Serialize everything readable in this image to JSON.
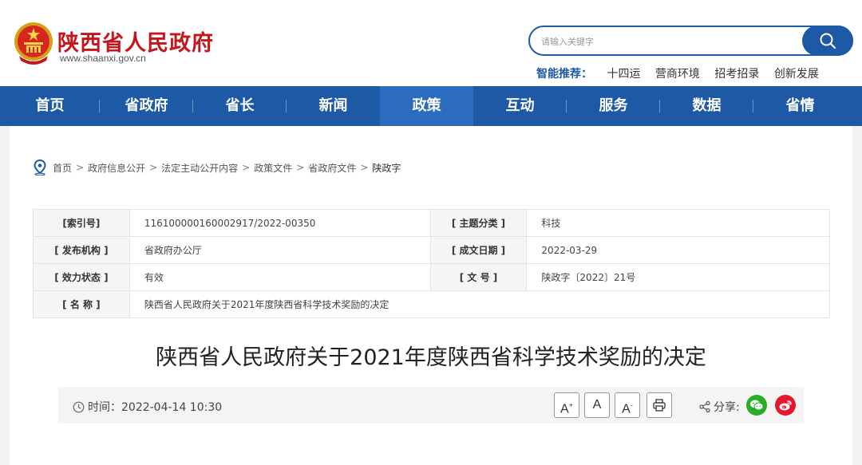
{
  "header": {
    "site_name": "陕西省人民政府",
    "site_url": "www.shaanxi.gov.cn",
    "search_placeholder": "请输入关键字",
    "recommend_label": "智能推荐：",
    "recommend_links": [
      "十四运",
      "营商环境",
      "招考招录",
      "创新发展"
    ]
  },
  "nav": {
    "items": [
      "首页",
      "省政府",
      "省长",
      "新闻",
      "政策",
      "互动",
      "服务",
      "数据",
      "省情"
    ],
    "active": "政策"
  },
  "breadcrumb": [
    "首页",
    "政府信息公开",
    "法定主动公开内容",
    "政策文件",
    "省政府文件",
    "陕政字"
  ],
  "breadcrumb_sep": ">",
  "info": {
    "index_label": "[索引号]",
    "index_value": "116100000160002917/2022-00350",
    "topic_label": "[ 主题分类 ]",
    "topic_value": "科技",
    "issuer_label": "[ 发布机构 ]",
    "issuer_value": "省政府办公厅",
    "date_label": "[ 成文日期 ]",
    "date_value": "2022-03-29",
    "status_label": "[ 效力状态 ]",
    "status_value": "有效",
    "docno_label": "[ 文 号 ]",
    "docno_value": "陕政字〔2022〕21号",
    "name_label": "[ 名 称 ]",
    "name_value": "陕西省人民政府关于2021年度陕西省科学技术奖励的决定"
  },
  "document": {
    "title": "陕西省人民政府关于2021年度陕西省科学技术奖励的决定",
    "time_text": "时间：2022-04-14 10:30"
  },
  "toolbar": {
    "font_large": "A",
    "font_large_sup": "+",
    "font_normal": "A",
    "font_small": "A",
    "font_small_sup": "-",
    "share_label": "分享:"
  },
  "colors": {
    "brand_blue": "#1e59a5",
    "brand_red": "#c4161c",
    "wechat_green": "#2aae28",
    "weibo_red": "#e6162d"
  },
  "icons": [
    "national-emblem-icon",
    "search-icon",
    "location-icon",
    "clock-icon",
    "print-icon",
    "share-icon",
    "wechat-icon",
    "weibo-icon"
  ]
}
